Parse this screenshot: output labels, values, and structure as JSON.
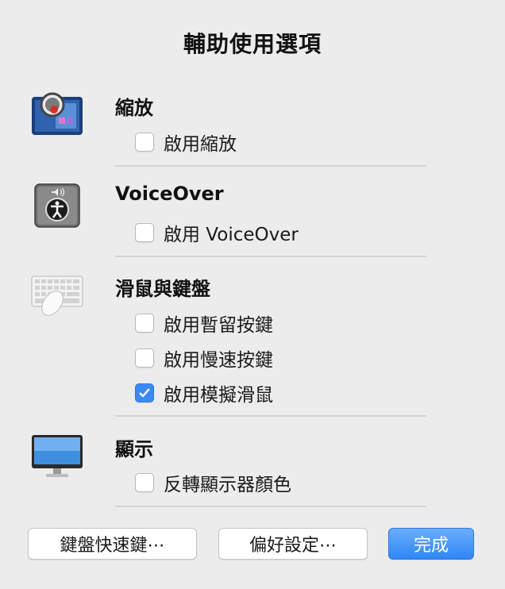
{
  "dialog": {
    "title": "輔助使用選項"
  },
  "sections": [
    {
      "title": "縮放",
      "icon": "zoom-icon",
      "options": [
        {
          "label": "啟用縮放",
          "checked": false
        }
      ]
    },
    {
      "title": "VoiceOver",
      "icon": "voiceover-icon",
      "options": [
        {
          "label": "啟用 VoiceOver",
          "checked": false
        }
      ]
    },
    {
      "title": "滑鼠與鍵盤",
      "icon": "keyboard-mouse-icon",
      "options": [
        {
          "label": "啟用暫留按鍵",
          "checked": false
        },
        {
          "label": "啟用慢速按鍵",
          "checked": false
        },
        {
          "label": "啟用模擬滑鼠",
          "checked": true
        }
      ]
    },
    {
      "title": "顯示",
      "icon": "display-icon",
      "options": [
        {
          "label": "反轉顯示器顏色",
          "checked": false
        }
      ]
    }
  ],
  "buttons": {
    "keyboard_shortcuts": "鍵盤快速鍵⋯",
    "preferences": "偏好設定⋯",
    "done": "完成"
  },
  "colors": {
    "accent": "#3b89f7",
    "background": "#ececec"
  }
}
